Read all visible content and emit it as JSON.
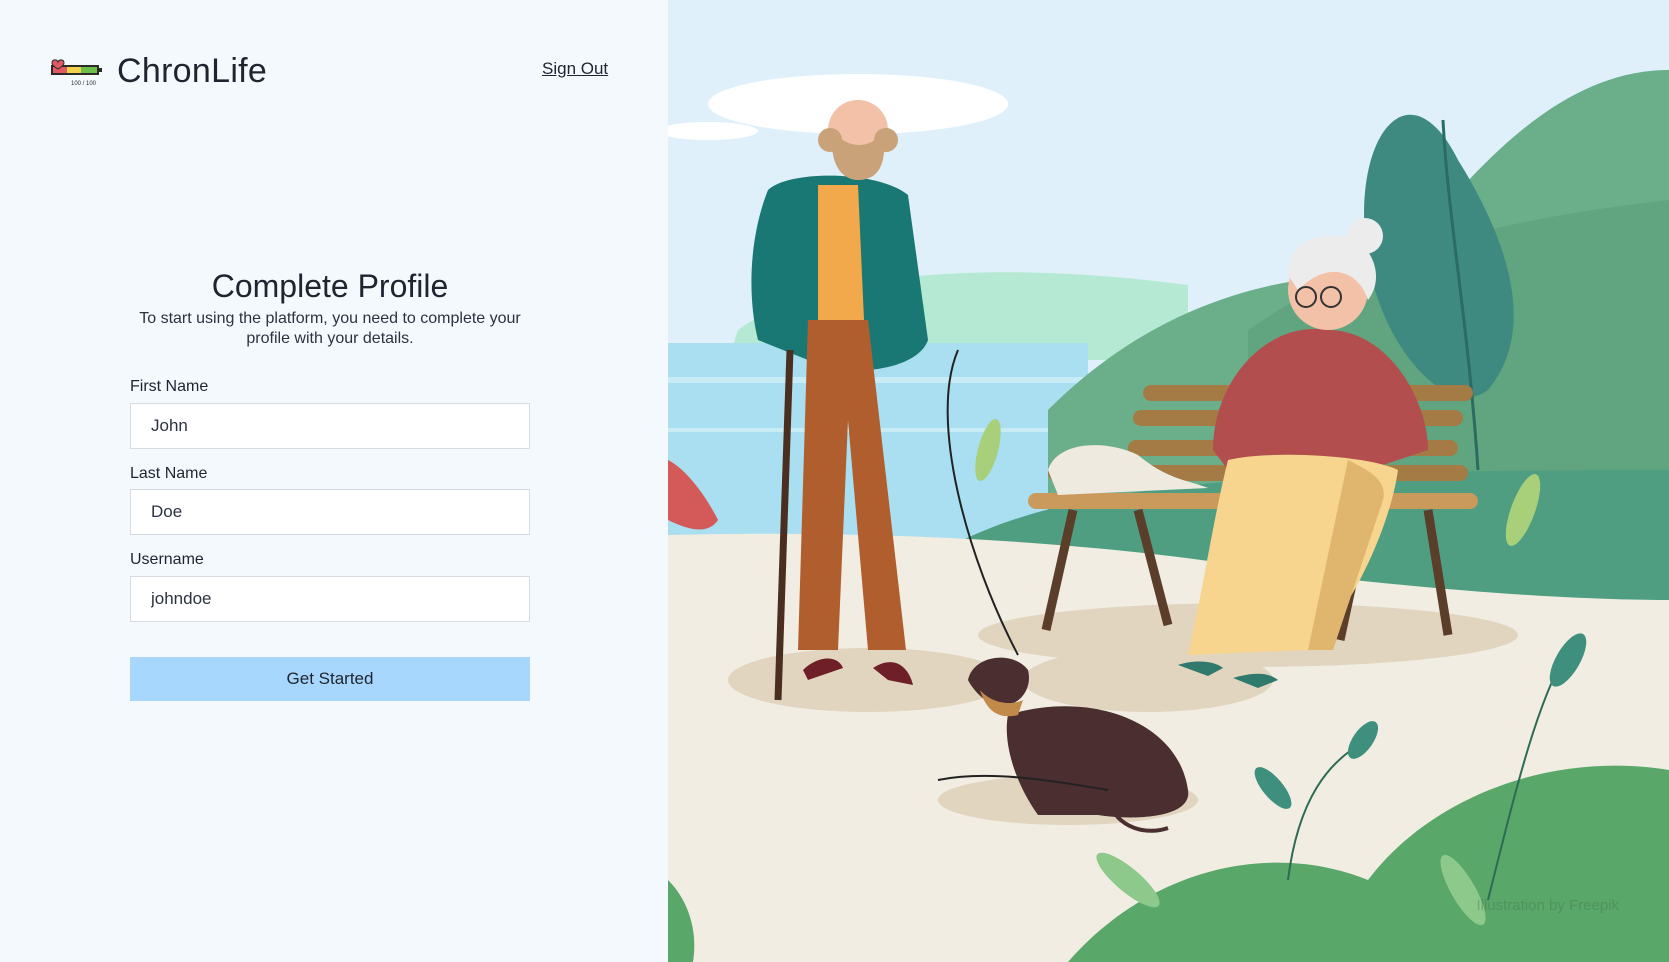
{
  "app": {
    "name": "ChronLife",
    "logo_caption": "100 / 100"
  },
  "header": {
    "sign_out": "Sign Out"
  },
  "form": {
    "title": "Complete Profile",
    "subtitle": "To start using the platform, you need to complete your profile with your details.",
    "first_name": {
      "label": "First Name",
      "value": "John"
    },
    "last_name": {
      "label": "Last Name",
      "value": "Doe"
    },
    "username": {
      "label": "Username",
      "value": "johndoe"
    },
    "submit": "Get Started"
  },
  "illustration": {
    "credit": "Illustration by Freepik"
  },
  "colors": {
    "accent": "#a8d7fd",
    "panel_bg": "#f4f9fd",
    "sky": "#dff0fb"
  }
}
